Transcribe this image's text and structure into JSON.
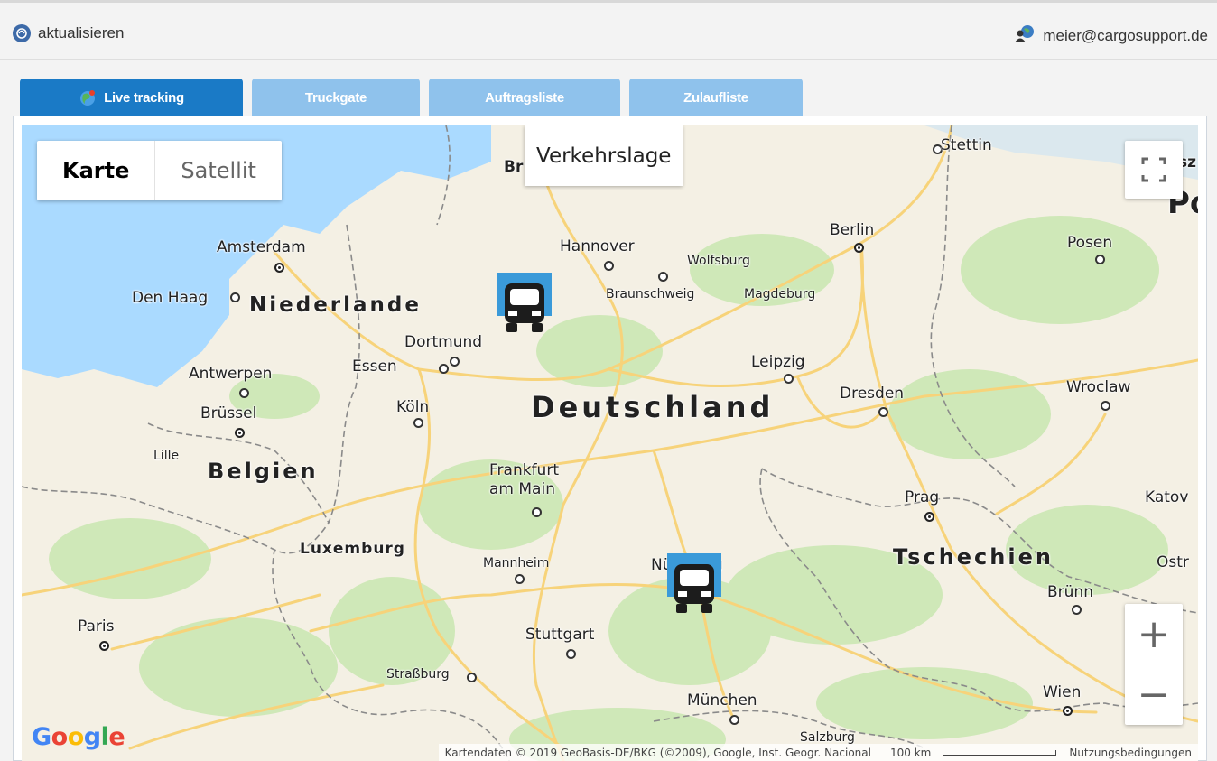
{
  "header": {
    "refresh_label": "aktualisieren",
    "user_email": "meier@cargosupport.de"
  },
  "tabs": [
    {
      "label": "Live tracking",
      "active": true
    },
    {
      "label": "Truckgate",
      "active": false
    },
    {
      "label": "Auftragsliste",
      "active": false
    },
    {
      "label": "Zulaufliste",
      "active": false
    }
  ],
  "map": {
    "type_control": {
      "map": "Karte",
      "satellite": "Satellit"
    },
    "traffic_label": "Verkehrslage",
    "zoom_in": "+",
    "zoom_out": "−",
    "google_logo": "Google",
    "attribution": "Kartendaten © 2019 GeoBasis-DE/BKG (©2009), Google, Inst. Geogr. Nacional",
    "scale": "100 km",
    "terms": "Nutzungsbedingungen",
    "countries": {
      "de": "Deutschland",
      "nl": "Niederlande",
      "be": "Belgien",
      "cz": "Tschechien",
      "lu": "Luxemburg",
      "pl_partial": "Po"
    },
    "cities": {
      "stettin": "Stettin",
      "berlin": "Berlin",
      "hannover": "Hannover",
      "wolfsburg": "Wolfsburg",
      "braunschweig": "Braunschweig",
      "magdeburg": "Magdeburg",
      "posen": "Posen",
      "amsterdam": "Amsterdam",
      "den_haag": "Den Haag",
      "dortmund": "Dortmund",
      "essen": "Essen",
      "antwerpen": "Antwerpen",
      "leipzig": "Leipzig",
      "dresden": "Dresden",
      "wroclaw": "Wroclaw",
      "bruessel": "Brüssel",
      "koeln": "Köln",
      "lille": "Lille",
      "frankfurt": "Frankfurt\nam Main",
      "prag": "Prag",
      "katow": "Katov",
      "mannheim": "Mannheim",
      "nuernberg": "Nürnberg",
      "ostr": "Ostr",
      "bruenn": "Brünn",
      "paris": "Paris",
      "stuttgart": "Stuttgart",
      "strassburg": "Straßburg",
      "muenchen": "München",
      "wien": "Wien",
      "salzburg": "Salzburg",
      "bremen": "Br",
      "bsz": "sz"
    }
  },
  "icons": {
    "refresh": "refresh-globe-icon",
    "user": "user-globe-icon",
    "tab": "globe-icon",
    "truck": "truck-icon",
    "fullscreen": "fullscreen-icon"
  },
  "colors": {
    "tab_active": "#1a7ac6",
    "tab_inactive": "#8fc2ec",
    "truck_bg": "#3a9ad9",
    "road": "#f7d37a",
    "water": "#aadaff",
    "forest": "#c8e6b1"
  }
}
